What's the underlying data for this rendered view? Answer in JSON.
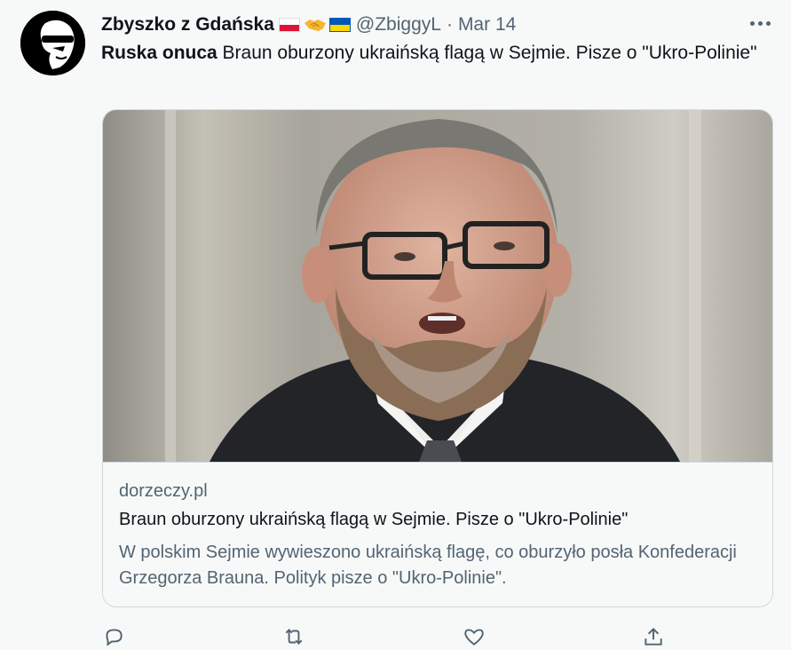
{
  "tweet": {
    "author_name": "Zbyszko z Gdańska",
    "handle": "@ZbiggyL",
    "separator": "·",
    "date": "Mar 14",
    "text_bold": "Ruska onuca",
    "text_body": " Braun oburzony ukraińską flagą w Sejmie. Pisze o \"Ukro-Polinie\"",
    "flags": [
      "poland-flag-icon",
      "handshake-icon",
      "ukraine-flag-icon"
    ]
  },
  "card": {
    "domain": "dorzeczy.pl",
    "title": "Braun oburzony ukraińską flagą w Sejmie. Pisze o \"Ukro-Polinie\"",
    "description": "W polskim Sejmie wywieszono ukraińską flagę, co oburzyło posła Konfederacji Grzegorza Brauna. Polityk pisze o \"Ukro-Polinie\"."
  },
  "actions": [
    "reply-icon",
    "retweet-icon",
    "like-icon",
    "share-icon"
  ],
  "colors": {
    "background": "#f7f9f9",
    "primary_text": "#0f1419",
    "secondary_text": "#536471",
    "border": "#cfd9de"
  }
}
